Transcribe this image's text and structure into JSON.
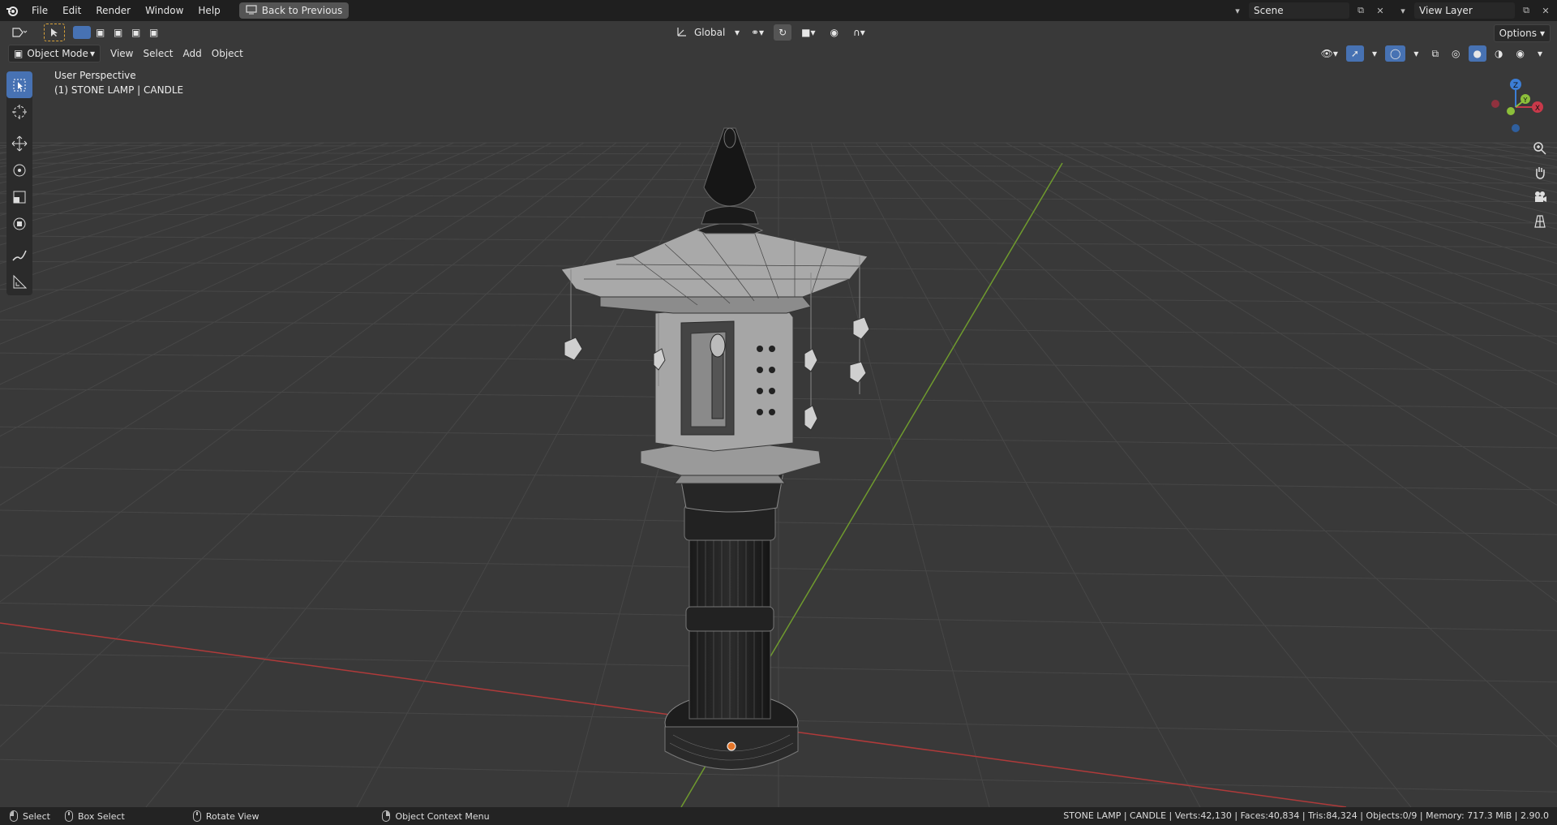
{
  "menu": {
    "file": "File",
    "edit": "Edit",
    "render": "Render",
    "window": "Window",
    "help": "Help",
    "back_to_previous": "Back to Previous"
  },
  "scene": {
    "value": "Scene"
  },
  "view_layer": {
    "value": "View Layer"
  },
  "header": {
    "transform_orientation": "Global",
    "options": "Options"
  },
  "modebar": {
    "mode": "Object Mode",
    "view": "View",
    "select": "Select",
    "add": "Add",
    "object": "Object"
  },
  "viewport": {
    "perspective": "User Perspective",
    "object_info": "(1) STONE LAMP | CANDLE"
  },
  "gizmo": {
    "x": "X",
    "y": "Y",
    "z": "Z"
  },
  "colors": {
    "x_axis": "#c8394a",
    "y_axis": "#8cbf3a",
    "z_axis": "#3c7ed6",
    "accent": "#4772b3"
  },
  "status": {
    "select": "Select",
    "box_select": "Box Select",
    "rotate_view": "Rotate View",
    "context_menu": "Object Context Menu",
    "stats": "STONE LAMP | CANDLE | Verts:42,130 | Faces:40,834 | Tris:84,324 | Objects:0/9 | Memory: 717.3 MiB | 2.90.0"
  }
}
